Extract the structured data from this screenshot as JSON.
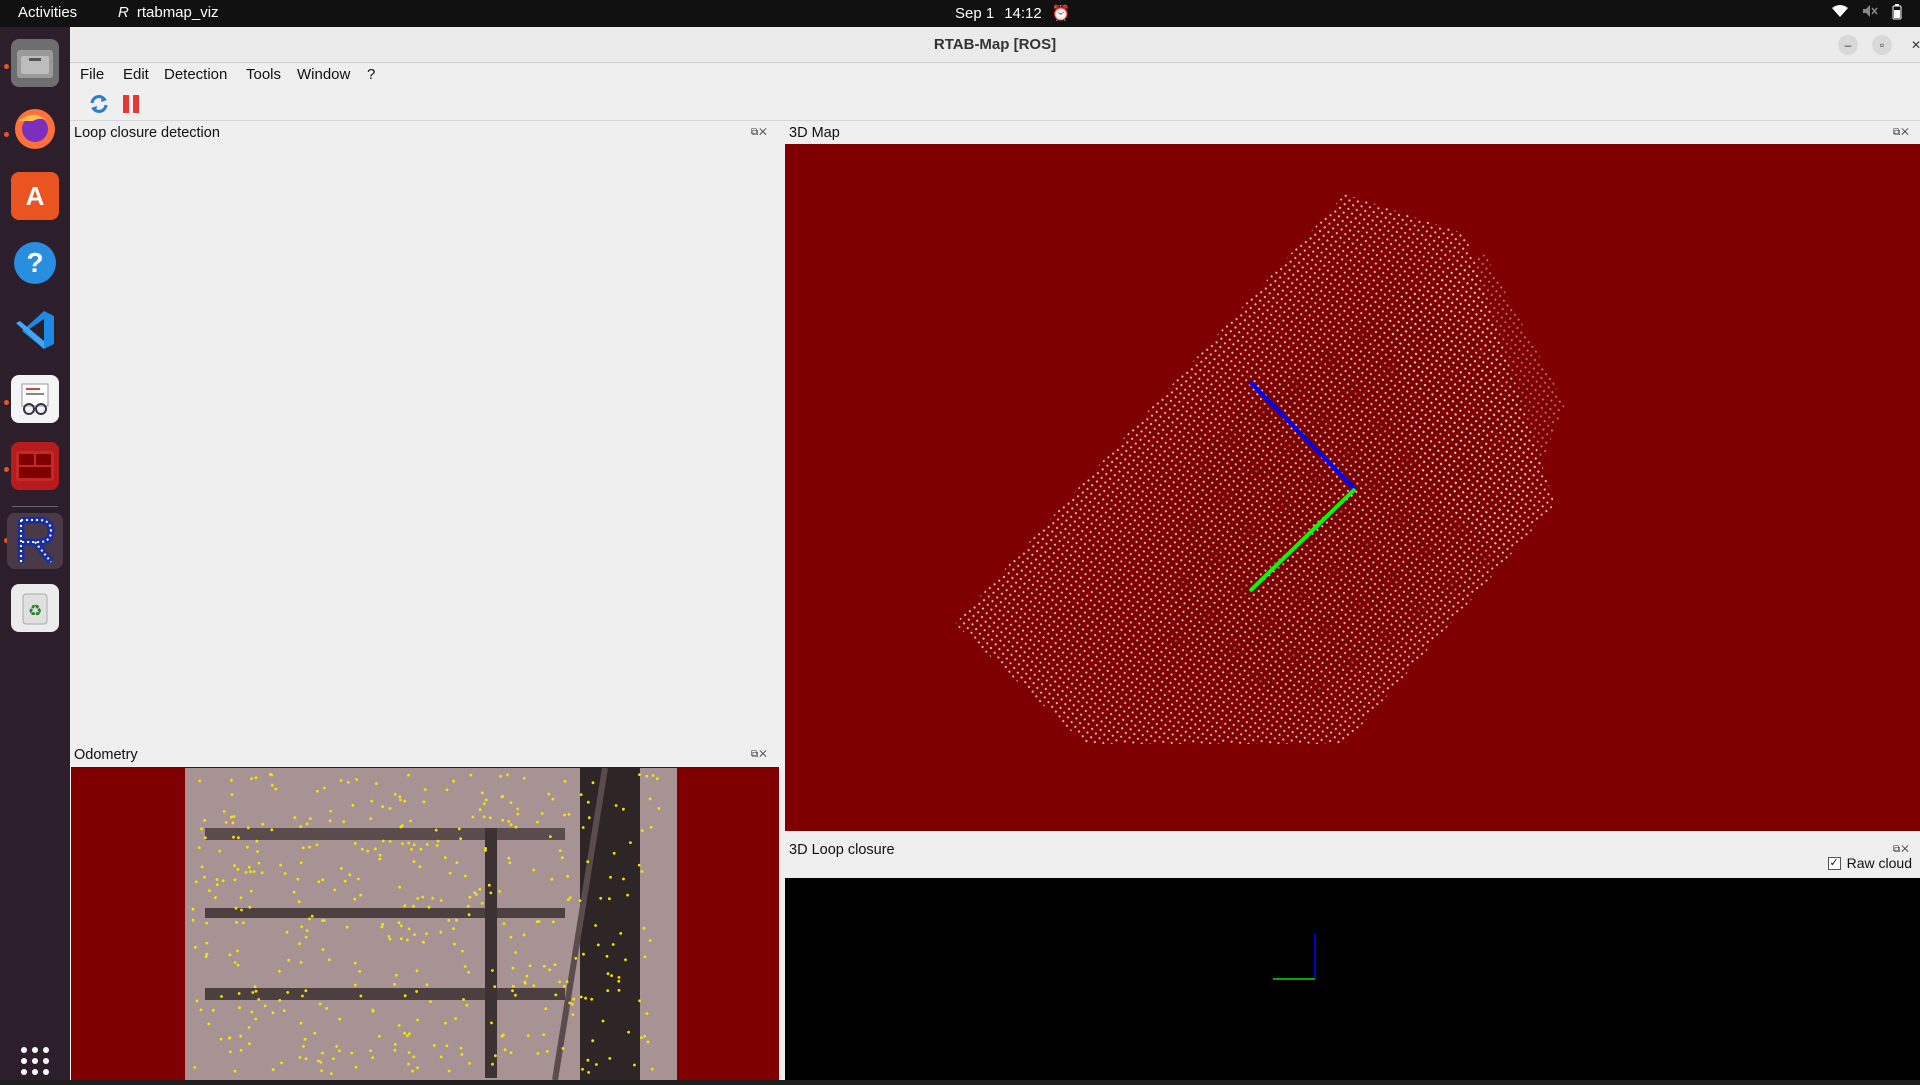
{
  "topbar": {
    "activities": "Activities",
    "app_name": "rtabmap_viz",
    "date": "Sep 1",
    "time": "14:12"
  },
  "dock": {
    "items": [
      "files-icon",
      "firefox-icon",
      "app-center-icon",
      "help-icon",
      "vscode-icon",
      "document-viewer-icon",
      "terminal-icon",
      "rtabmap-icon",
      "trash-icon"
    ],
    "grid_label": "Show Apps"
  },
  "window": {
    "title": "RTAB-Map [ROS]"
  },
  "menu": [
    "File",
    "Edit",
    "Detection",
    "Tools",
    "Window",
    "?"
  ],
  "panels": {
    "loop_closure": "Loop closure detection",
    "map3d": "3D Map",
    "odometry": "Odometry",
    "loop3d": "3D Loop closure"
  },
  "loop3d": {
    "raw_cloud_label": "Raw  cloud",
    "raw_cloud_checked": true
  },
  "colors": {
    "map_background": "#7f0000",
    "accent": "#e95420"
  }
}
